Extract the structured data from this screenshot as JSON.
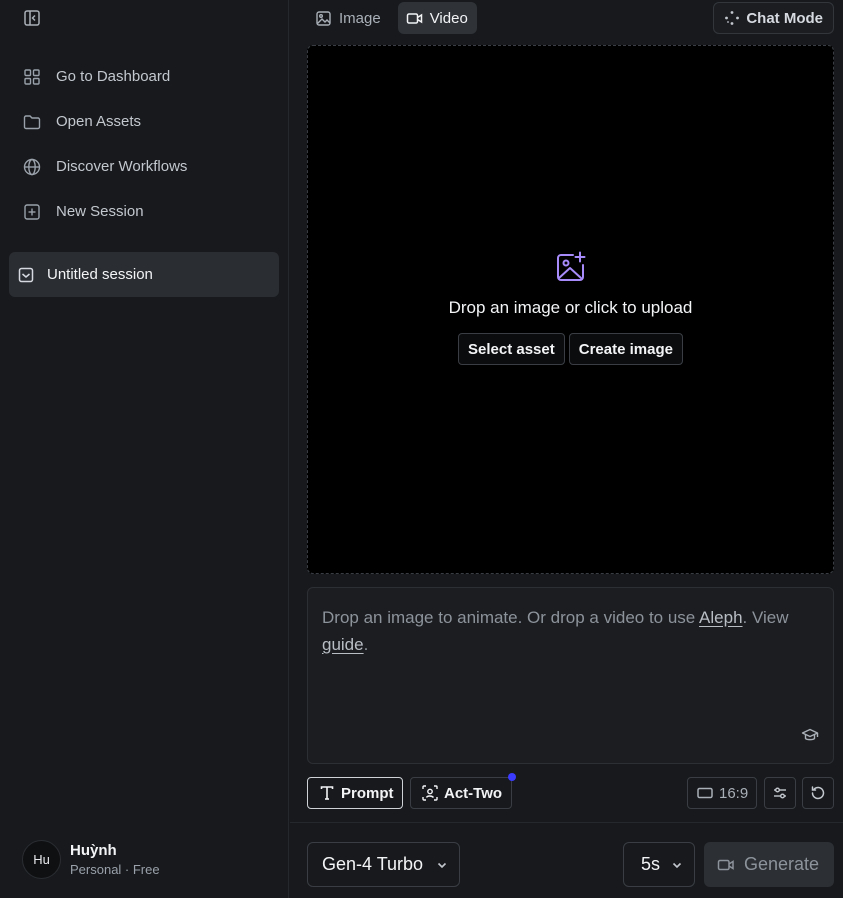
{
  "sidebar": {
    "items": [
      {
        "label": "Go to Dashboard",
        "icon": "grid-icon"
      },
      {
        "label": "Open Assets",
        "icon": "folder-icon"
      },
      {
        "label": "Discover Workflows",
        "icon": "globe-icon"
      },
      {
        "label": "New Session",
        "icon": "plus-square-icon"
      }
    ],
    "session": {
      "label": "Untitled session",
      "icon": "session-icon"
    }
  },
  "user": {
    "initials": "Hu",
    "name": "Huỳnh",
    "plan": "Personal · Free"
  },
  "modes": {
    "image_label": "Image",
    "video_label": "Video",
    "active": "Video",
    "chat_mode_label": "Chat Mode"
  },
  "upload": {
    "text": "Drop an image or click to upload",
    "select_asset": "Select asset",
    "create_image": "Create image"
  },
  "prompt": {
    "part1": "Drop an image to animate. Or drop a video to use ",
    "aleph_link": "Aleph",
    "part2": ". View ",
    "guide_link": "guide",
    "part3": "."
  },
  "tools": {
    "prompt_label": "Prompt",
    "act_two_label": "Act-Two",
    "aspect_ratio": "16:9"
  },
  "footer": {
    "model": "Gen-4 Turbo",
    "duration": "5s",
    "generate_label": "Generate"
  },
  "colors": {
    "accent_icon": "#a78bfa",
    "badge_dot": "#3b3bff",
    "background": "#17191c"
  }
}
